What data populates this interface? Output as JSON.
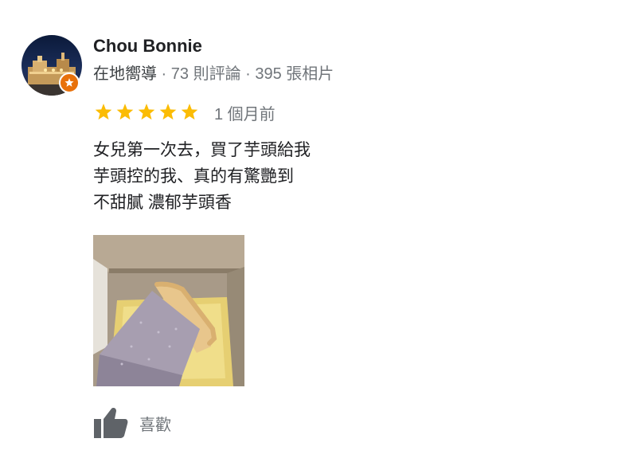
{
  "reviewer": {
    "name": "Chou Bonnie",
    "level": "在地嚮導",
    "separator": " · ",
    "reviews_count": "73 則評論",
    "photos_count": "395 張相片"
  },
  "rating": {
    "stars": 5,
    "max_stars": 5,
    "date": "1 個月前"
  },
  "review": {
    "lines": [
      "女兒第一次去，買了芋頭給我",
      "芋頭控的我、真的有驚艷到",
      "不甜膩 濃郁芋頭香"
    ]
  },
  "actions": {
    "like_label": "喜歡"
  },
  "icons": {
    "star": "star-icon",
    "like": "thumbs-up-icon",
    "badge": "local-guide-star-icon"
  },
  "colors": {
    "star": "#fbbc04",
    "badge": "#e8710a",
    "name": "#202124",
    "meta": "#70757a"
  }
}
